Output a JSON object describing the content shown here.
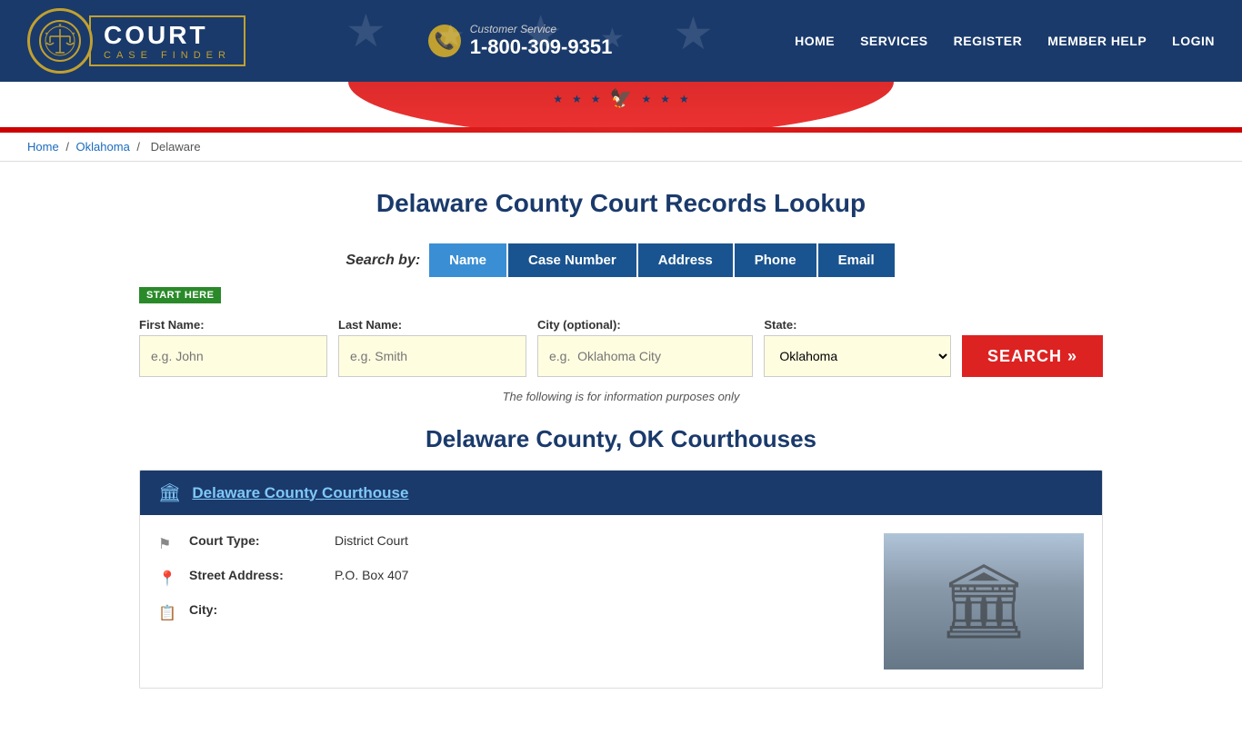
{
  "header": {
    "logo_court": "COURT",
    "logo_case_finder": "CASE FINDER",
    "customer_service_label": "Customer Service",
    "phone_number": "1-800-309-9351",
    "nav": [
      {
        "label": "HOME",
        "href": "#"
      },
      {
        "label": "SERVICES",
        "href": "#"
      },
      {
        "label": "REGISTER",
        "href": "#"
      },
      {
        "label": "MEMBER HELP",
        "href": "#"
      },
      {
        "label": "LOGIN",
        "href": "#"
      }
    ]
  },
  "breadcrumb": {
    "home": "Home",
    "state": "Oklahoma",
    "county": "Delaware"
  },
  "page_title": "Delaware County Court Records Lookup",
  "search": {
    "search_by_label": "Search by:",
    "tabs": [
      {
        "label": "Name",
        "active": true
      },
      {
        "label": "Case Number",
        "active": false
      },
      {
        "label": "Address",
        "active": false
      },
      {
        "label": "Phone",
        "active": false
      },
      {
        "label": "Email",
        "active": false
      }
    ],
    "start_here_badge": "START HERE",
    "fields": {
      "first_name_label": "First Name:",
      "first_name_placeholder": "e.g. John",
      "last_name_label": "Last Name:",
      "last_name_placeholder": "e.g. Smith",
      "city_label": "City (optional):",
      "city_placeholder": "e.g.  Oklahoma City",
      "state_label": "State:",
      "state_value": "Oklahoma"
    },
    "search_button": "SEARCH »",
    "info_note": "The following is for information purposes only"
  },
  "courthouses_section": {
    "title": "Delaware County, OK Courthouses",
    "courthouses": [
      {
        "name": "Delaware County Courthouse",
        "details": [
          {
            "label": "Court Type:",
            "value": "District Court",
            "icon": "⚑"
          },
          {
            "label": "Street Address:",
            "value": "P.O. Box 407",
            "icon": "📍"
          }
        ]
      }
    ]
  }
}
